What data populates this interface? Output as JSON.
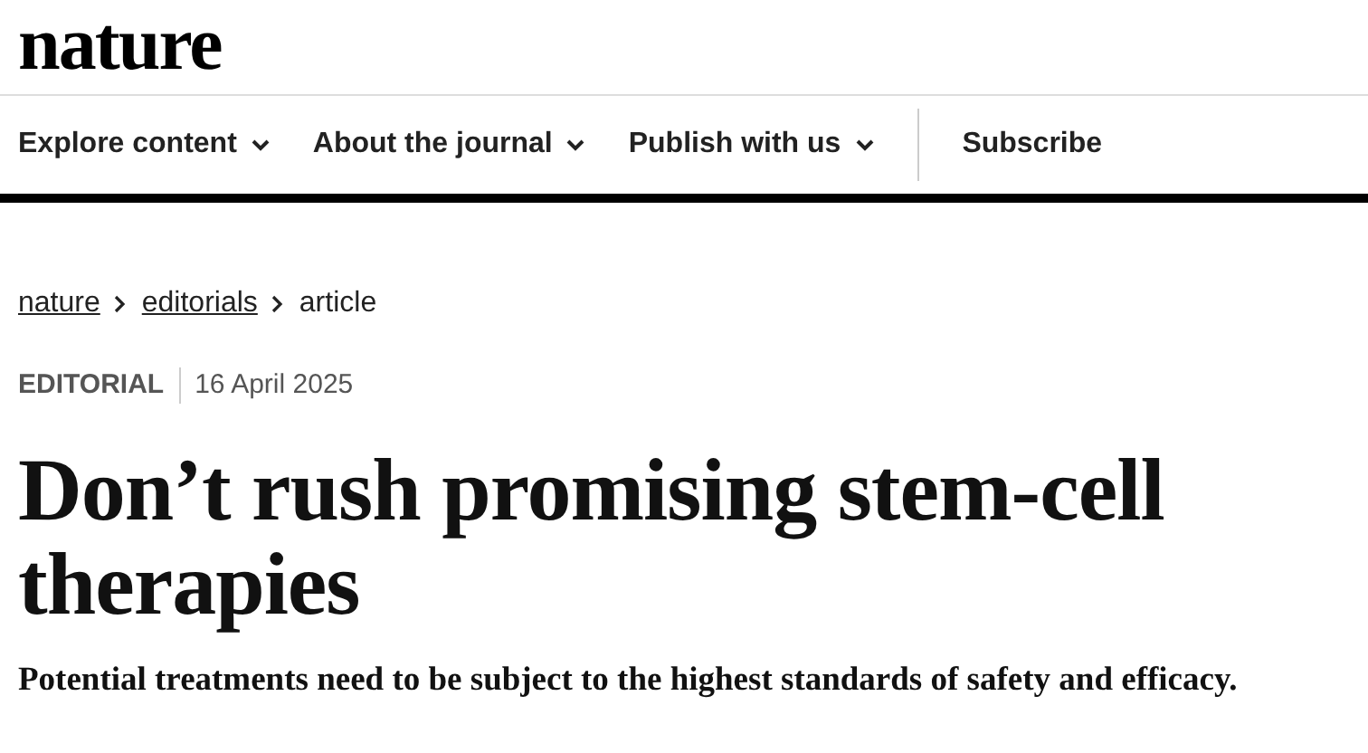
{
  "logo": "nature",
  "nav": [
    {
      "label": "Explore content",
      "dropdown": true
    },
    {
      "label": "About the journal",
      "dropdown": true
    },
    {
      "label": "Publish with us",
      "dropdown": true
    },
    {
      "label": "Subscribe",
      "dropdown": false
    }
  ],
  "breadcrumb": [
    {
      "label": "nature",
      "link": true
    },
    {
      "label": "editorials",
      "link": true
    },
    {
      "label": "article",
      "link": false
    }
  ],
  "article": {
    "type": "EDITORIAL",
    "date": "16 April 2025",
    "title": "Don’t rush promising stem-cell therapies",
    "standfirst": "Potential treatments need to be subject to the highest standards of safety and efficacy."
  }
}
